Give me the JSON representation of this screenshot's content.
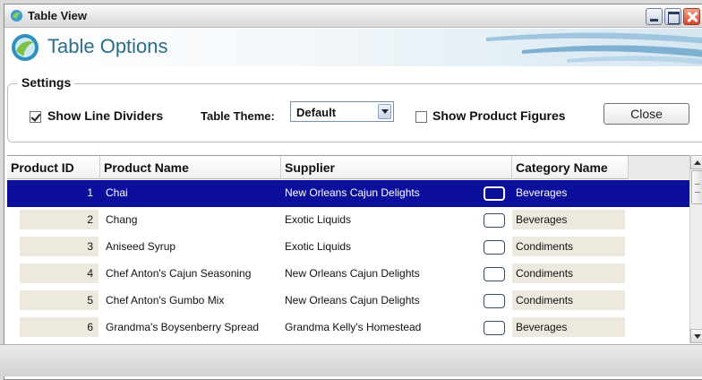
{
  "window": {
    "title": "Table View"
  },
  "banner": {
    "title": "Table Options"
  },
  "settings": {
    "legend": "Settings",
    "show_line_dividers": {
      "label": "Show Line Dividers",
      "checked": true
    },
    "table_theme": {
      "label": "Table Theme:",
      "value": "Default"
    },
    "show_product_figures": {
      "label": "Show Product Figures",
      "checked": false
    },
    "close_label": "Close"
  },
  "table": {
    "columns": [
      "Product ID",
      "Product Name",
      "Supplier",
      "Category Name"
    ],
    "rows": [
      {
        "id": "1",
        "name": "Chai",
        "supplier": "New Orleans Cajun Delights",
        "category": "Beverages",
        "selected": true
      },
      {
        "id": "2",
        "name": "Chang",
        "supplier": "Exotic Liquids",
        "category": "Beverages"
      },
      {
        "id": "3",
        "name": "Aniseed Syrup",
        "supplier": "Exotic Liquids",
        "category": "Condiments"
      },
      {
        "id": "4",
        "name": "Chef Anton's Cajun Seasoning",
        "supplier": "New Orleans Cajun Delights",
        "category": "Condiments"
      },
      {
        "id": "5",
        "name": "Chef Anton's Gumbo Mix",
        "supplier": "New Orleans Cajun Delights",
        "category": "Condiments"
      },
      {
        "id": "6",
        "name": "Grandma's Boysenberry Spread",
        "supplier": "Grandma Kelly's Homestead",
        "category": "Beverages"
      }
    ]
  },
  "colors": {
    "selection": "#0b0f9c",
    "banner_title": "#2c6d88",
    "id_cell_bg": "#ede9df"
  }
}
